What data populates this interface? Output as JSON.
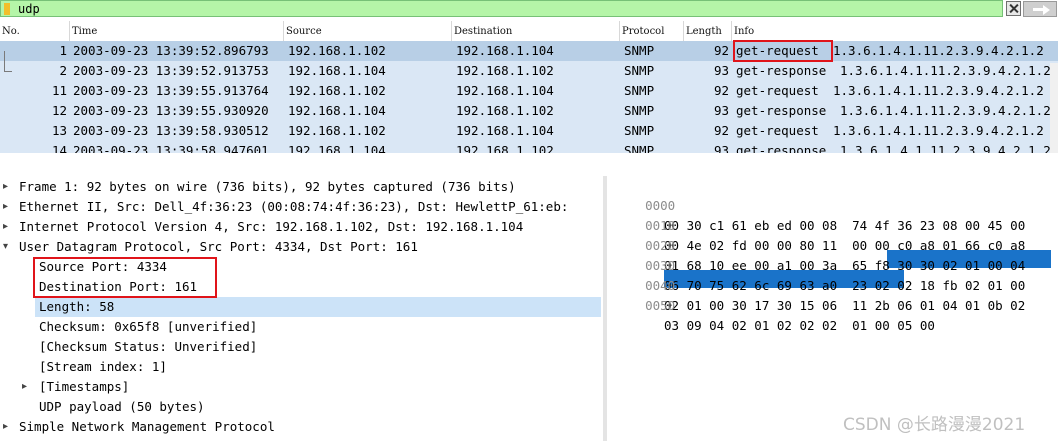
{
  "filter": {
    "value": "udp"
  },
  "columns": {
    "no": "No.",
    "time": "Time",
    "source": "Source",
    "destination": "Destination",
    "protocol": "Protocol",
    "length": "Length",
    "info": "Info"
  },
  "packets": [
    {
      "no": "1",
      "time": "2003-09-23 13:39:52.896793",
      "source": "192.168.1.102",
      "destination": "192.168.1.104",
      "protocol": "SNMP",
      "length": "92",
      "info_type": "get-request",
      "info_oid": "1.3.6.1.4.1.11.2.3.9.4.2.1.2"
    },
    {
      "no": "2",
      "time": "2003-09-23 13:39:52.913753",
      "source": "192.168.1.104",
      "destination": "192.168.1.102",
      "protocol": "SNMP",
      "length": "93",
      "info_type": "get-response",
      "info_oid": "1.3.6.1.4.1.11.2.3.9.4.2.1.2"
    },
    {
      "no": "11",
      "time": "2003-09-23 13:39:55.913764",
      "source": "192.168.1.102",
      "destination": "192.168.1.104",
      "protocol": "SNMP",
      "length": "92",
      "info_type": "get-request",
      "info_oid": "1.3.6.1.4.1.11.2.3.9.4.2.1.2"
    },
    {
      "no": "12",
      "time": "2003-09-23 13:39:55.930920",
      "source": "192.168.1.104",
      "destination": "192.168.1.102",
      "protocol": "SNMP",
      "length": "93",
      "info_type": "get-response",
      "info_oid": "1.3.6.1.4.1.11.2.3.9.4.2.1.2"
    },
    {
      "no": "13",
      "time": "2003-09-23 13:39:58.930512",
      "source": "192.168.1.102",
      "destination": "192.168.1.104",
      "protocol": "SNMP",
      "length": "92",
      "info_type": "get-request",
      "info_oid": "1.3.6.1.4.1.11.2.3.9.4.2.1.2"
    },
    {
      "no": "14",
      "time": "2003-09-23 13:39:58.947601",
      "source": "192.168.1.104",
      "destination": "192.168.1.102",
      "protocol": "SNMP",
      "length": "93",
      "info_type": "get-response",
      "info_oid": "1.3.6.1.4.1.11.2.3.9.4.2.1.2"
    }
  ],
  "details": {
    "frame": "Frame 1: 92 bytes on wire (736 bits), 92 bytes captured (736 bits)",
    "ethernet": "Ethernet II, Src: Dell_4f:36:23 (00:08:74:4f:36:23), Dst: HewlettP_61:eb:",
    "ip": "Internet Protocol Version 4, Src: 192.168.1.102, Dst: 192.168.1.104",
    "udp": "User Datagram Protocol, Src Port: 4334, Dst Port: 161",
    "src_port": "Source Port: 4334",
    "dst_port": "Destination Port: 161",
    "length": "Length: 58",
    "checksum": "Checksum: 0x65f8 [unverified]",
    "checksum_status": "[Checksum Status: Unverified]",
    "stream_index": "[Stream index: 1]",
    "timestamps": "[Timestamps]",
    "payload": "UDP payload (50 bytes)",
    "snmp": "Simple Network Management Protocol"
  },
  "hex": {
    "rows": [
      {
        "offset": "0000",
        "bytes": "00 30 c1 61 eb ed 00 08  74 4f 36 23 08 00 45 00"
      },
      {
        "offset": "0010",
        "bytes": "00 4e 02 fd 00 00 80 11  00 00 c0 a8 01 66 c0 a8"
      },
      {
        "offset": "0020",
        "bytes": "01 68 10 ee 00 a1 00 3a  65 f8 30 30 02 01 00 04"
      },
      {
        "offset": "0030",
        "bytes": "06 70 75 62 6c 69 63 a0  23 02 02 18 fb 02 01 00"
      },
      {
        "offset": "0040",
        "bytes": "02 01 00 30 17 30 15 06  11 2b 06 01 04 01 0b 02"
      },
      {
        "offset": "0050",
        "bytes": "03 09 04 02 01 02 02 02  01 00 05 00"
      }
    ]
  },
  "watermark": "CSDN @长路漫漫2021",
  "colors": {
    "filter_bg": "#b5f5a8",
    "selected_row": "#b8cfe6",
    "row": "#dae7f5",
    "selected_detail": "#cce3f8",
    "hex_highlight": "#1a73c9",
    "annotation": "#e0141a"
  }
}
